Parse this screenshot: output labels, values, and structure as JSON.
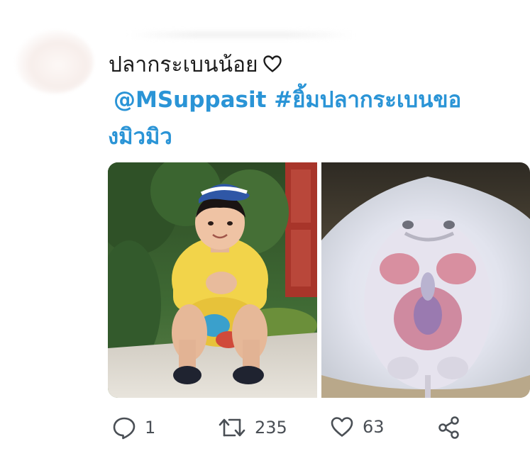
{
  "tweet": {
    "author_name": "ปลากระเบนน้อย",
    "name_heart_icon": "heart-outline-icon",
    "line1": "@MSuppasit #ยิ้มปลากระเบนขอ",
    "line2": "งมิวมิว",
    "link_color": "#2a94d6",
    "media": [
      {
        "description_icon": "photo-boy-in-yellow-shirt"
      },
      {
        "description_icon": "photo-stingray-underside"
      }
    ]
  },
  "actions": {
    "reply": {
      "icon": "reply-icon",
      "count": "1"
    },
    "retweet": {
      "icon": "retweet-icon",
      "count": "235"
    },
    "like": {
      "icon": "heart-icon",
      "count": "63"
    },
    "share": {
      "icon": "share-icon"
    }
  }
}
